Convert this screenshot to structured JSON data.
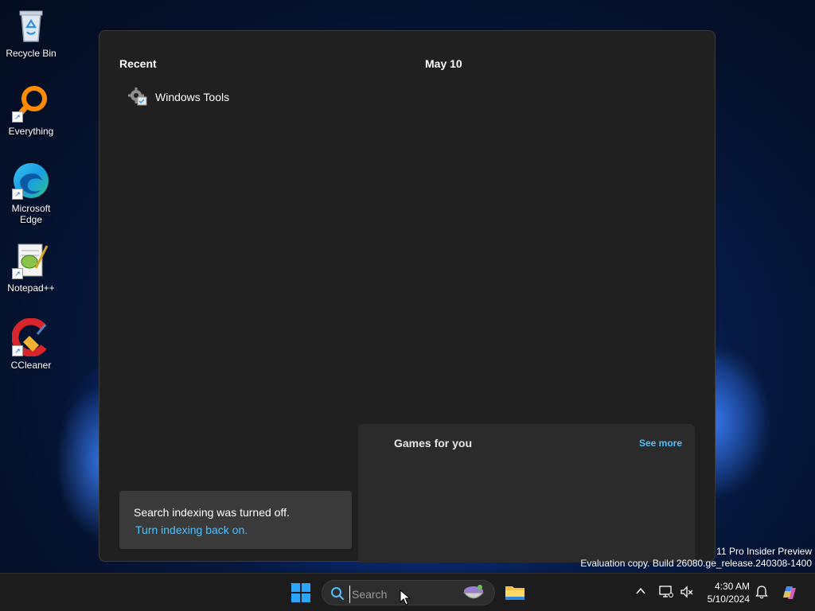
{
  "desktop": {
    "icons": [
      {
        "label": "Recycle Bin",
        "icon": "recycle-bin-icon"
      },
      {
        "label": "Everything",
        "icon": "everything-search-icon"
      },
      {
        "label": "Microsoft Edge",
        "icon": "edge-icon"
      },
      {
        "label": "Notepad++",
        "icon": "notepadpp-icon"
      },
      {
        "label": "CCleaner",
        "icon": "ccleaner-icon"
      }
    ]
  },
  "search_panel": {
    "recent_heading": "Recent",
    "date_heading": "May 10",
    "recent_items": [
      {
        "label": "Windows Tools",
        "icon": "windows-tools-icon"
      }
    ],
    "notice": {
      "message": "Search indexing was turned off.",
      "link": "Turn indexing back on."
    },
    "games": {
      "title": "Games for you",
      "see_more": "See more"
    }
  },
  "watermark": {
    "line1": "11 Pro Insider Preview",
    "line2": "Evaluation copy. Build 26080.ge_release.240308-1400"
  },
  "taskbar": {
    "search_placeholder": "Search",
    "clock_time": "4:30 AM",
    "clock_date": "5/10/2024"
  },
  "colors": {
    "accent_link": "#4cc2ff",
    "panel_bg": "#202020",
    "taskbar_bg": "#1c1c1c"
  }
}
